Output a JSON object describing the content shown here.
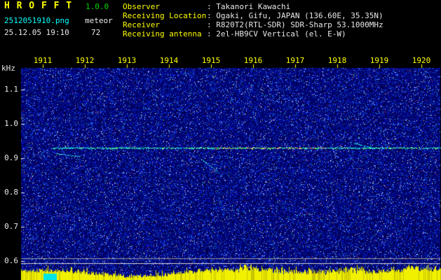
{
  "header": {
    "title": "H R O F F T",
    "version": "1.0.0",
    "filename": "2512051910.png",
    "mode": "meteor",
    "timestamp": "25.12.05 19:10",
    "count": "72",
    "info": [
      {
        "label": "Observer",
        "value": ": Takanori Kawachi"
      },
      {
        "label": "Receiving Location",
        "value": ": Ogaki, Gifu, JAPAN (136.60E, 35.35N)"
      },
      {
        "label": "Receiver",
        "value": ": R820T2(RTL-SDR) SDR-Sharp 53.1000MHz"
      },
      {
        "label": "Receiving antenna",
        "value": ": 2el-HB9CV Vertical (el. E-W)"
      }
    ]
  },
  "colors": {
    "background": "#000000",
    "title": "#ffff00",
    "version": "#00d800",
    "filename": "#00ffff",
    "text": "#e8e8e8",
    "label": "#ffff00",
    "axis_text": "#e8e8e8",
    "time_text": "#ffff00",
    "noise_base": "#000080",
    "carrier": "#00e8c8",
    "meter_bar": "#f0f000",
    "meter_marker": "#00e4e4"
  },
  "chart_data": {
    "type": "heatmap",
    "subtype": "radio-meteor-echo-spectrogram",
    "y_axis_label": "kHz",
    "x": {
      "unit": "hhmm",
      "tick_labels": [
        "1911",
        "1912",
        "1913",
        "1914",
        "1915",
        "1916",
        "1917",
        "1918",
        "1919",
        "1920"
      ]
    },
    "y": {
      "unit": "kHz",
      "tick_labels": [
        "1.1",
        "1.0",
        "0.9",
        "0.8",
        "0.7",
        "0.6"
      ],
      "range": [
        0.55,
        1.16
      ]
    },
    "series": [
      {
        "name": "carrier-trace",
        "freq_khz": 0.93,
        "time_start": 1911.23,
        "time_end": 1920.45,
        "palette_note": "cyan-green trace with yellow-green middle and red segment near 1917.5"
      },
      {
        "name": "meteor-echo-1",
        "time_start": 1911.32,
        "time_end": 1911.88,
        "freq_start": 0.914,
        "freq_end": 0.906
      },
      {
        "name": "meteor-echo-2",
        "time_start": 1914.77,
        "time_end": 1915.2,
        "freq_start": 0.898,
        "freq_end": 0.857
      },
      {
        "name": "meteor-echo-3",
        "time_start": 1918.32,
        "time_end": 1918.83,
        "freq_start": 0.947,
        "freq_end": 0.931
      }
    ],
    "level_meter": {
      "position": "bottom",
      "bar_color": "#f0f000",
      "marker_color": "#00e4e4",
      "marker_time_start": 1911.02,
      "marker_time_end": 1911.33
    },
    "background_note": "dense blue noise field with sparse white, red and green specks"
  }
}
